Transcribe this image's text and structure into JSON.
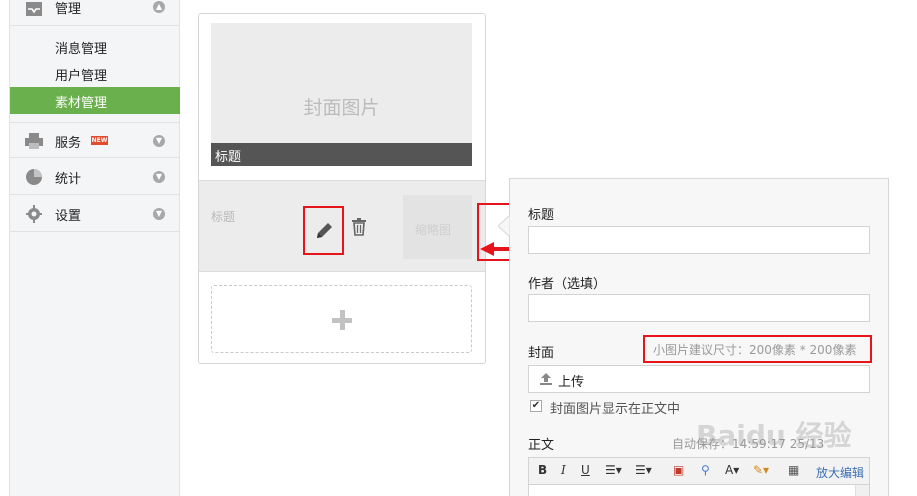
{
  "sidebar": {
    "groups": {
      "manage": {
        "label": "管理",
        "icon": "inbox-icon"
      },
      "service": {
        "label": "服务",
        "badge": "NEW",
        "icon": "printer-icon"
      },
      "stats": {
        "label": "统计",
        "icon": "pie-chart-icon"
      },
      "settings": {
        "label": "设置",
        "icon": "gear-icon"
      }
    },
    "manage_items": [
      "消息管理",
      "用户管理",
      "素材管理"
    ],
    "active_item": "素材管理"
  },
  "article_list": {
    "cover_placeholder": "封面图片",
    "cover_title": "标题",
    "item_title": "标题",
    "item_thumb": "缩略图"
  },
  "editor": {
    "title_label": "标题",
    "author_label": "作者（选填）",
    "cover_label": "封面",
    "cover_hint": "小图片建议尺寸：200像素 * 200像素",
    "upload_label": "上传",
    "show_cover_label": "封面图片显示在正文中",
    "show_cover_checked": true,
    "body_label": "正文",
    "autosave_text": "自动保存：14:59:17 25/13",
    "toolbar": {
      "bold": "B",
      "italic": "I",
      "underline": "U",
      "zoom_edit": "放大编辑"
    }
  },
  "watermark": "Baidu 经验",
  "colors": {
    "active_green": "#6ab04c",
    "highlight_red": "#e8141c",
    "new_badge": "#e24a2c",
    "link_blue": "#3a6fb5"
  }
}
